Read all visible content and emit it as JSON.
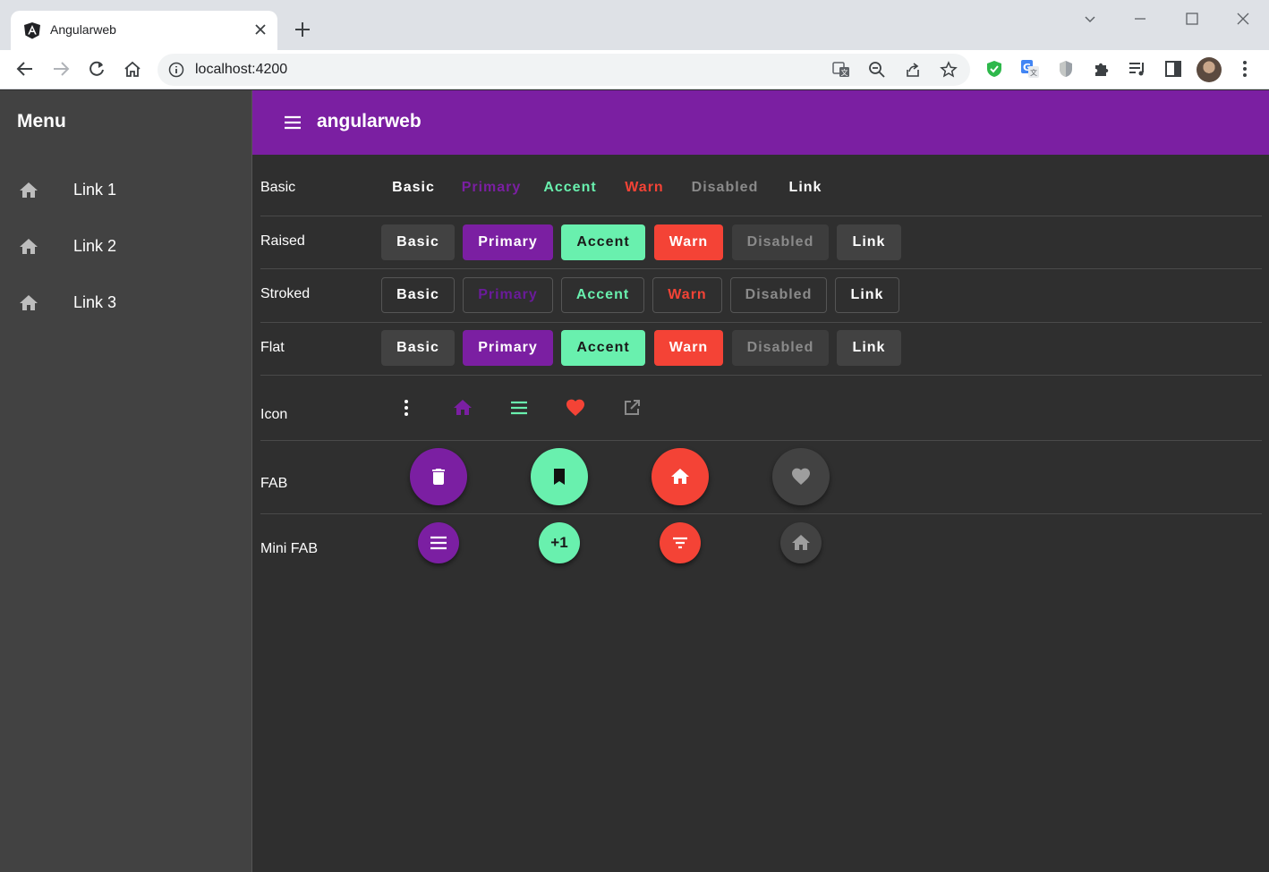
{
  "browser": {
    "tab_title": "Angularweb",
    "url": "localhost:4200"
  },
  "sidenav": {
    "title": "Menu",
    "links": [
      {
        "label": "Link 1",
        "icon": "home-icon"
      },
      {
        "label": "Link 2",
        "icon": "home-icon"
      },
      {
        "label": "Link 3",
        "icon": "home-icon"
      }
    ]
  },
  "appbar": {
    "title": "angularweb",
    "color": "#7b1fa2"
  },
  "sections": {
    "basic": {
      "label": "Basic",
      "buttons": [
        "Basic",
        "Primary",
        "Accent",
        "Warn",
        "Disabled",
        "Link"
      ]
    },
    "raised": {
      "label": "Raised",
      "buttons": [
        "Basic",
        "Primary",
        "Accent",
        "Warn",
        "Disabled",
        "Link"
      ]
    },
    "stroked": {
      "label": "Stroked",
      "buttons": [
        "Basic",
        "Primary",
        "Accent",
        "Warn",
        "Disabled",
        "Link"
      ]
    },
    "flat": {
      "label": "Flat",
      "buttons": [
        "Basic",
        "Primary",
        "Accent",
        "Warn",
        "Disabled",
        "Link"
      ]
    },
    "icon": {
      "label": "Icon",
      "icons": [
        "more-vert-icon",
        "home-icon",
        "menu-icon",
        "favorite-icon",
        "open-in-new-icon"
      ]
    },
    "fab": {
      "label": "FAB",
      "icons": [
        "delete-icon",
        "bookmark-icon",
        "home-icon",
        "favorite-icon"
      ]
    },
    "minifab": {
      "label": "Mini FAB",
      "icons": [
        "menu-icon",
        "plus-one-icon",
        "filter-list-icon",
        "home-icon"
      ],
      "plus_one_text": "+1"
    }
  },
  "colors": {
    "primary": "#7b1fa2",
    "accent": "#69f0ae",
    "warn": "#f44336",
    "background": "#2f2f2f",
    "sidenav": "#424242"
  }
}
